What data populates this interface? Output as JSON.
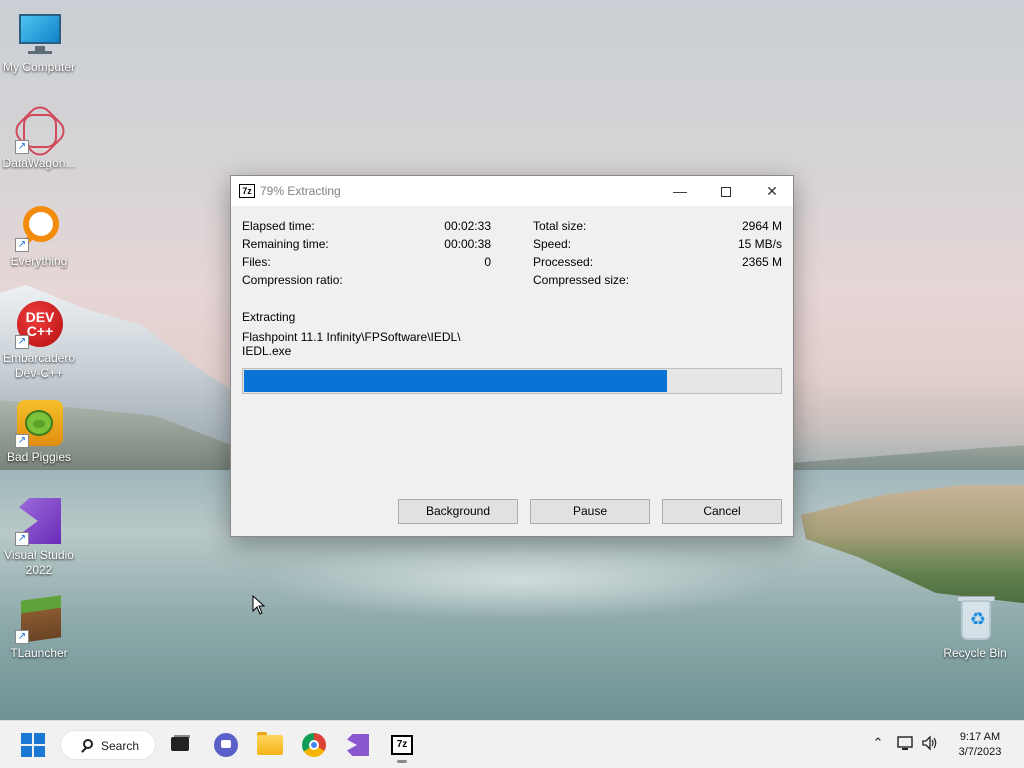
{
  "desktop": {
    "icons": [
      {
        "label": "My Computer"
      },
      {
        "label": "DataWagon..."
      },
      {
        "label": "Everything"
      },
      {
        "label": "Embarcadero Dev-C++",
        "logo_text": "DEV C++"
      },
      {
        "label": "Bad Piggies"
      },
      {
        "label": "Visual Studio 2022"
      },
      {
        "label": "TLauncher"
      },
      {
        "label": "Recycle Bin"
      }
    ]
  },
  "dialog": {
    "app_icon": "7z",
    "title": "79% Extracting",
    "stats_left": [
      {
        "label": "Elapsed time:",
        "value": "00:02:33"
      },
      {
        "label": "Remaining time:",
        "value": "00:00:38"
      },
      {
        "label": "Files:",
        "value": "0"
      },
      {
        "label": "Compression ratio:",
        "value": ""
      }
    ],
    "stats_right": [
      {
        "label": "Total size:",
        "value": "2964 M"
      },
      {
        "label": "Speed:",
        "value": "15 MB/s"
      },
      {
        "label": "Processed:",
        "value": "2365 M"
      },
      {
        "label": "Compressed size:",
        "value": ""
      }
    ],
    "status_label": "Extracting",
    "file_path_line1": "Flashpoint 11.1 Infinity\\FPSoftware\\IEDL\\",
    "file_path_line2": "IEDL.exe",
    "progress_percent": 79,
    "buttons": {
      "background": "Background",
      "pause": "Pause",
      "cancel": "Cancel"
    }
  },
  "taskbar": {
    "search_label": "Search",
    "apps": [
      "task-view",
      "chat",
      "file-explorer",
      "chrome",
      "visual-studio",
      "7-zip"
    ],
    "time": "9:17 AM",
    "date": "3/7/2023"
  },
  "colors": {
    "progress_fill": "#0a73d6",
    "accent": "#1a78d4"
  }
}
